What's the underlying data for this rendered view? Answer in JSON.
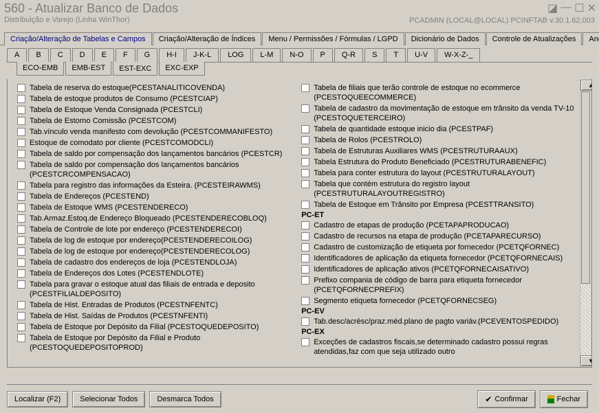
{
  "window": {
    "title": "560 - Atualizar Banco de Dados",
    "subtitle": "Distribuição e Varejo (Linha WinThor)",
    "user_info": "PCADMIN (LOCAL@LOCAL)   PCINFTAB  v.30.1.62.003"
  },
  "main_tabs": [
    "Criação/Alteração de Tabelas e Campos",
    "Criação/Alteração de Índices",
    "Menu / Permissões / Fórmulas / LGPD",
    "Dicionário de Dados",
    "Controle de Atualizações",
    "Andame"
  ],
  "letters": [
    "A",
    "B",
    "C",
    "D",
    "E",
    "F",
    "G",
    "H-I",
    "J-K-L",
    "LOG",
    "L-M",
    "N-O",
    "P",
    "Q-R",
    "S",
    "T",
    "U-V",
    "W-X-Z-_"
  ],
  "letters_active": 4,
  "subtabs": [
    "ECO-EMB",
    "EMB-EST",
    "EST-EXC",
    "EXC-EXP"
  ],
  "subtabs_active": 2,
  "left": [
    "Tabela de reserva do estoque(PCESTANALITICOVENDA)",
    "Tabela de estoque produtos de Consumo (PCESTCIAP)",
    "Tabela de Estoque Venda Consignada (PCESTCLI)",
    "Tabela de Estorno Comissão (PCESTCOM)",
    "Tab.vínculo venda manifesto com devolução (PCESTCOMMANIFESTO)",
    "Estoque de comodato por cliente (PCESTCOMODCLI)",
    "Tabela de saldo por compensação dos lançamentos bancários (PCESTCR)",
    "Tabela de saldo por compensação dos lançamentos bancários (PCESTCRCOMPENSACAO)",
    "Tabela para registro das informações da Esteira. (PCESTEIRAWMS)",
    "Tabela de Endereços (PCESTEND)",
    "Tabela de Estoque WMS (PCESTENDERECO)",
    "Tab.Armaz.Estoq.de Endereço Bloqueado (PCESTENDERECOBLOQ)",
    "Tabela de Controle de lote por endereço (PCESTENDERECOI)",
    "Tabela de log de estoque por endereço(PCESTENDERECOILOG)",
    "Tabela de log de estoque por endereço(PCESTENDERECOLOG)",
    "Tabela de cadastro dos endereços de loja (PCESTENDLOJA)",
    "Tabela de Endereços dos Lotes (PCESTENDLOTE)",
    "Tabela para gravar o estoque atual das filiais de entrada e deposito (PCESTFILIALDEPOSITO)",
    "Tabela de Hist. Entradas de Produtos (PCESTNFENTC)",
    "Tabela de Hist. Saídas de Produtos (PCESTNFENTI)",
    "Tabela  de Estoque por Depósito da Filial (PCESTOQUEDEPOSITO)",
    "Tabela  de Estoque por Depósito da Filial e Produto (PCESTOQUEDEPOSITOPROD)"
  ],
  "right_groups": [
    {
      "head": null,
      "items": [
        "Tabela de filiais que terão controle de estoque no ecommerce (PCESTOQUEECOMMERCE)",
        "Tabela de cadastro da movimentação de estoque em trânsito da venda TV-10 (PCESTOQUETERCEIRO)",
        "Tabela de quantidade estoque inicio dia (PCESTPAF)",
        "Tabela de Rolos (PCESTROLO)",
        "Tabela de Estruturas Auxiliares WMS (PCESTRUTURAAUX)",
        "Tabela Estrutura do Produto Beneficiado (PCESTRUTURABENEFIC)",
        "Tabela para conter estrutura do layout (PCESTRUTURALAYOUT)",
        "Tabela que contém estrutura do registro layout (PCESTRUTURALAYOUTREGISTRO)",
        "Tabela de Estoque em Trânsito por Empresa (PCESTTRANSITO)"
      ]
    },
    {
      "head": "PC-ET",
      "items": [
        "Cadastro de etapas de produção (PCETAPAPRODUCAO)",
        "Cadastro de recursos na etapa de produção (PCETAPARECURSO)",
        "Cadastro de customização de etiqueta por fornecedor (PCETQFORNEC)",
        "Identificadores de aplicação da etiqueta fornecedor (PCETQFORNECAIS)",
        "Identificadores de aplicação ativos (PCETQFORNECAISATIVO)",
        "Prefixo compania de código de barra para etiqueta fornecedor (PCETQFORNECPREFIX)",
        "Segmento etiqueta fornecedor (PCETQFORNECSEG)"
      ]
    },
    {
      "head": "PC-EV",
      "items": [
        "Tab.desc/acrésc/praz.méd.plano de pagto variáv.(PCEVENTOSPEDIDO)"
      ]
    },
    {
      "head": "PC-EX",
      "items": [
        "Exceções de cadastros fiscais,se determinado cadastro possui regras atendidas,faz com que seja utilizado outro"
      ]
    }
  ],
  "footer": {
    "find": "Localizar (F2)",
    "select_all": "Selecionar Todos",
    "deselect_all": "Desmarca Todos",
    "confirm": "Confirmar",
    "close": "Fechar"
  }
}
